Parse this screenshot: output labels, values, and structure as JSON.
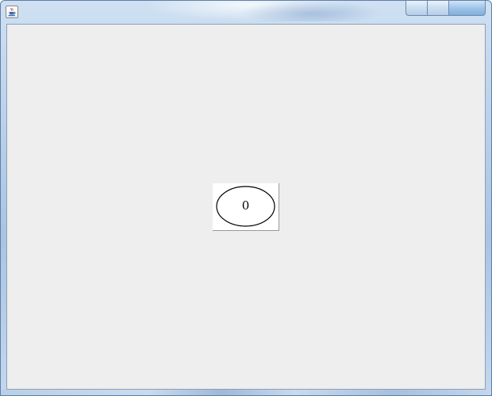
{
  "window": {
    "title": "",
    "app_icon": "java-coffee-cup-icon",
    "caption_buttons": [
      "minimize",
      "maximize",
      "close"
    ]
  },
  "canvas": {
    "background_color": "#eeeeee",
    "node": {
      "label": "0",
      "shape": "ellipse",
      "fill": "#ffffff",
      "stroke": "#000000"
    }
  }
}
